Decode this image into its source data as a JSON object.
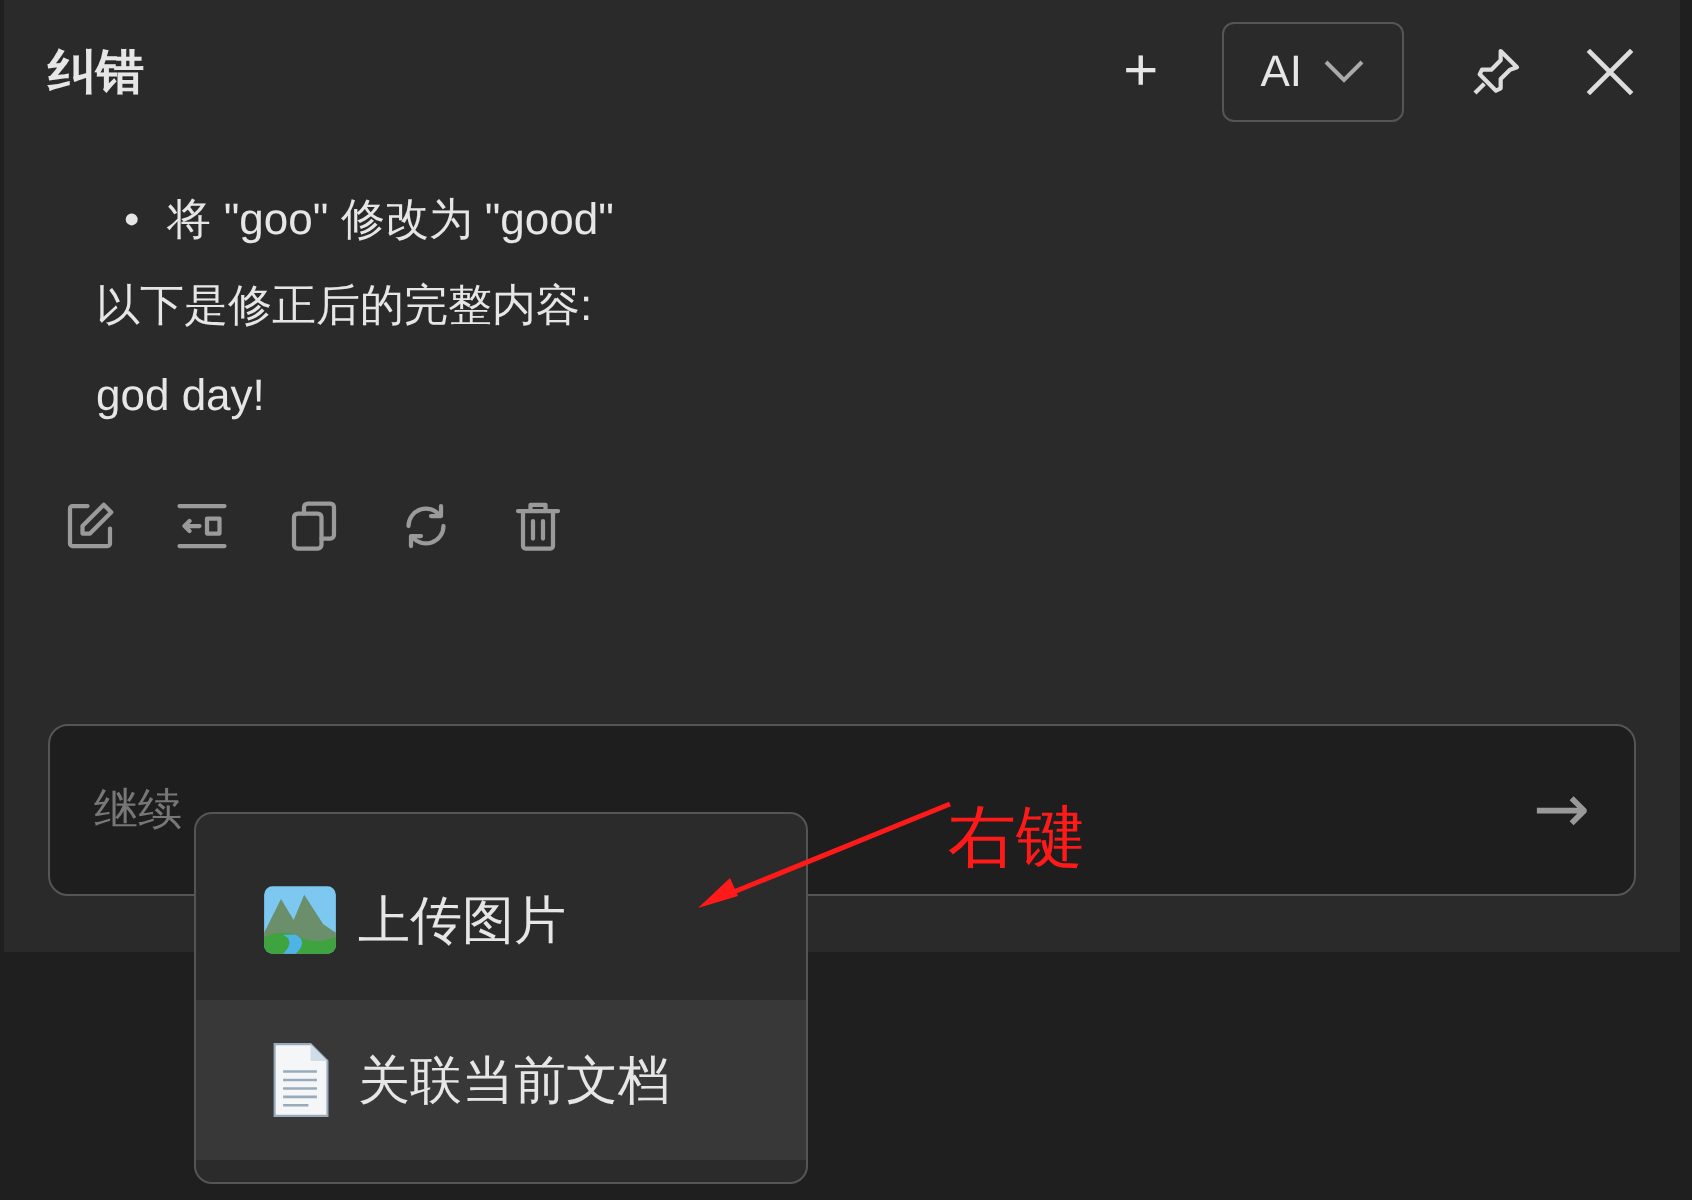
{
  "header": {
    "title": "纠错",
    "add_button": "+",
    "model_select": {
      "value": "AI"
    }
  },
  "message": {
    "bullet_marker": "•",
    "bullets": [
      "将 \"goo\" 修改为 \"good\""
    ],
    "paragraphs": [
      "以下是修正后的完整内容:",
      "god day!"
    ]
  },
  "actions": [
    {
      "kind": "edit"
    },
    {
      "kind": "insert"
    },
    {
      "kind": "copy"
    },
    {
      "kind": "regenerate"
    },
    {
      "kind": "delete"
    }
  ],
  "input": {
    "placeholder": "继续",
    "send": "→"
  },
  "context_menu": {
    "items": [
      {
        "kind": "image",
        "label": "上传图片",
        "selected": false
      },
      {
        "kind": "document",
        "label": "关联当前文档",
        "selected": true
      }
    ]
  },
  "annotation": {
    "text": "右键"
  }
}
